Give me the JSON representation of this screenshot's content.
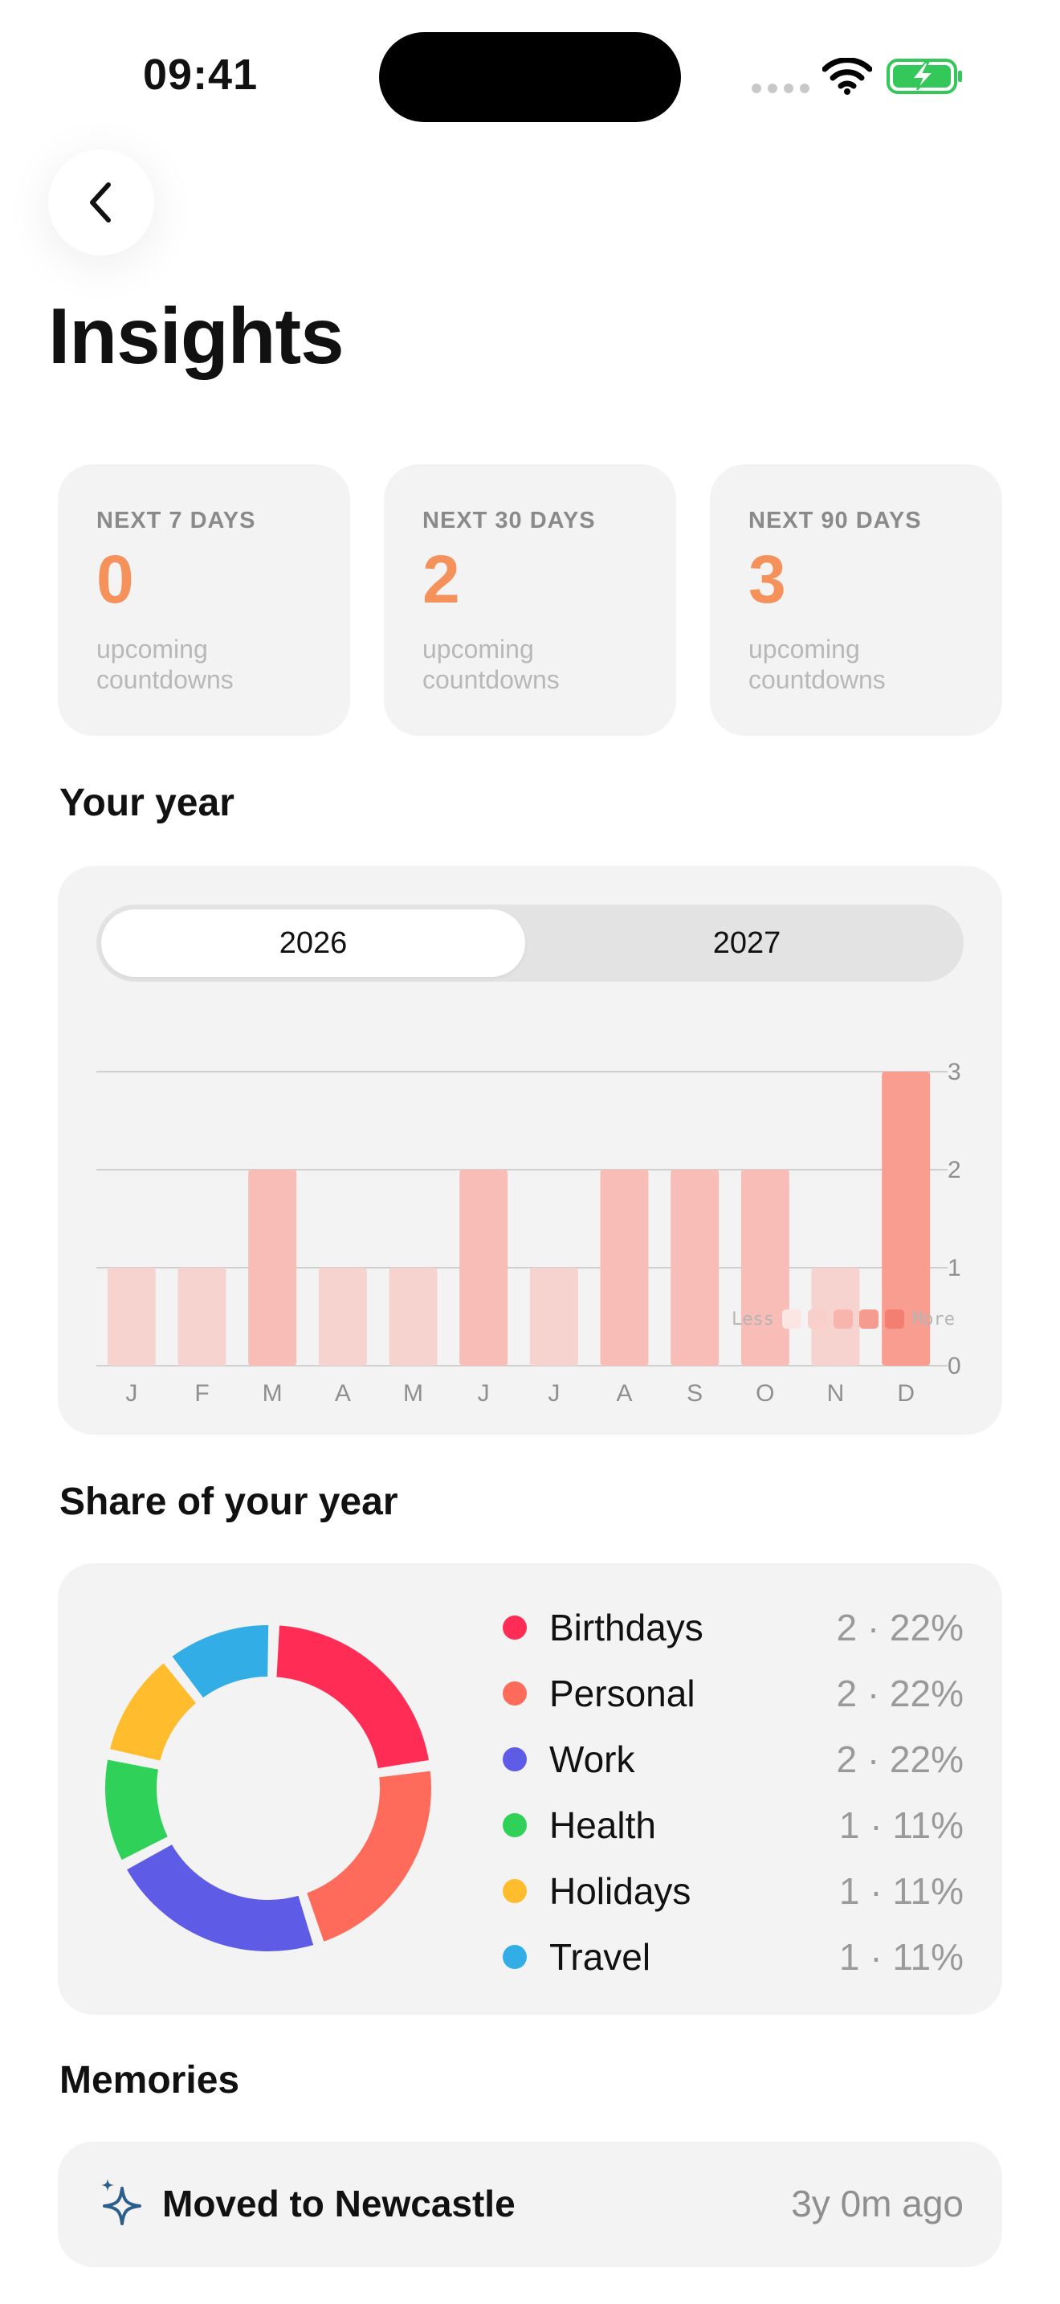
{
  "status_bar": {
    "time": "09:41"
  },
  "page": {
    "title": "Insights"
  },
  "stats": [
    {
      "label": "NEXT 7 DAYS",
      "value": "0",
      "sub": "upcoming countdowns"
    },
    {
      "label": "NEXT 30 DAYS",
      "value": "2",
      "sub": "upcoming countdowns"
    },
    {
      "label": "NEXT 90 DAYS",
      "value": "3",
      "sub": "upcoming countdowns"
    }
  ],
  "your_year": {
    "title": "Your year",
    "segments": [
      "2026",
      "2027"
    ],
    "selected_segment": "2026",
    "legend_less": "Less",
    "legend_more": "More"
  },
  "chart_data": {
    "type": "bar",
    "categories": [
      "J",
      "F",
      "M",
      "A",
      "M",
      "J",
      "J",
      "A",
      "S",
      "O",
      "N",
      "D"
    ],
    "values": [
      1,
      1,
      2,
      1,
      1,
      2,
      1,
      2,
      2,
      2,
      1,
      3
    ],
    "ylim": [
      0,
      3
    ],
    "yticks": [
      "0",
      "1",
      "2",
      "3"
    ],
    "grid": true,
    "colors_by_level": [
      "#f6d3cf",
      "#f8bdb6",
      "#f99d91"
    ],
    "legend_swatches": [
      "#fbe6e3",
      "#f8cfca",
      "#f7b5ad",
      "#f69b90",
      "#f37f72"
    ]
  },
  "share": {
    "title": "Share of your year",
    "items": [
      {
        "name": "Birthdays",
        "value": "2 · 22%",
        "color": "#ff2d55",
        "count": 2
      },
      {
        "name": "Personal",
        "value": "2 · 22%",
        "color": "#ff6b5a",
        "count": 2
      },
      {
        "name": "Work",
        "value": "2 · 22%",
        "color": "#5e5ce6",
        "count": 2
      },
      {
        "name": "Health",
        "value": "1 · 11%",
        "color": "#30d158",
        "count": 1
      },
      {
        "name": "Holidays",
        "value": "1 · 11%",
        "color": "#ffbd2e",
        "count": 1
      },
      {
        "name": "Travel",
        "value": "1 · 11%",
        "color": "#32ade6",
        "count": 1
      }
    ]
  },
  "memories": {
    "title": "Memories",
    "items": [
      {
        "icon": "sparkles-icon",
        "title": "Moved to Newcastle",
        "age": "3y 0m ago"
      }
    ]
  }
}
